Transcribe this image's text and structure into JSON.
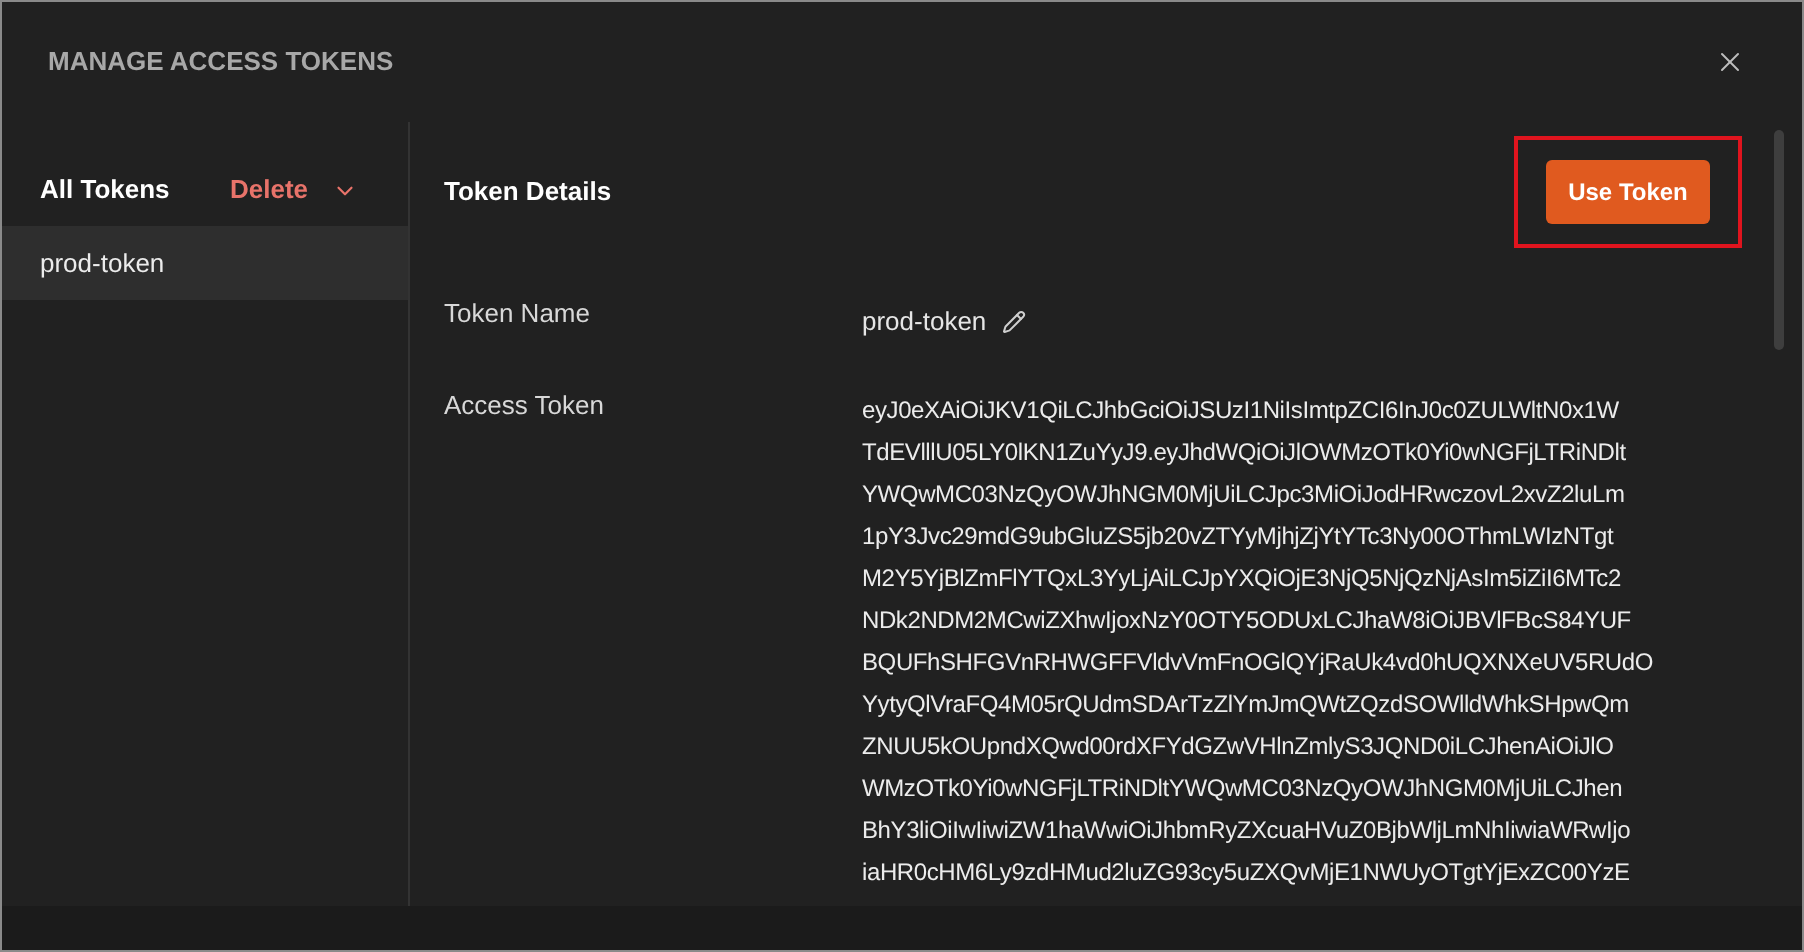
{
  "dialog": {
    "title": "MANAGE ACCESS TOKENS"
  },
  "sidebar": {
    "heading": "All Tokens",
    "delete_label": "Delete",
    "items": [
      {
        "label": "prod-token",
        "selected": true
      }
    ]
  },
  "details": {
    "heading": "Token Details",
    "use_button": "Use Token",
    "highlighted": true,
    "fields": [
      {
        "kind": "name",
        "label": "Token Name",
        "value": "prod-token"
      },
      {
        "kind": "token",
        "label": "Access Token",
        "lines": [
          "eyJ0eXAiOiJKV1QiLCJhbGciOiJSUzI1NiIsImtpZCI6InJ0c0ZULWltN0x1W",
          "TdEVlllU05LY0lKN1ZuYyJ9.eyJhdWQiOiJlOWMzOTk0Yi0wNGFjLTRiNDlt",
          "YWQwMC03NzQyOWJhNGM0MjUiLCJpc3MiOiJodHRwczovL2xvZ2luLm",
          "1pY3Jvc29mdG9ubGluZS5jb20vZTYyMjhjZjYtYTc3Ny00OThmLWIzNTgt",
          "M2Y5YjBlZmFlYTQxL3YyLjAiLCJpYXQiOjE3NjQ5NjQzNjAsIm5iZiI6MTc2",
          "NDk2NDM2MCwiZXhwIjoxNzY0OTY5ODUxLCJhaW8iOiJBVlFBcS84YUF",
          "BQUFhSHFGVnRHWGFFVldvVmFnOGlQYjRaUk4vd0hUQXNXeUV5RUdO",
          "YytyQlVraFQ4M05rQUdmSDArTzZlYmJmQWtZQzdSOWlldWhkSHpwQm",
          "ZNUU5kOUpndXQwd00rdXFYdGZwVHlnZmlyS3JQND0iLCJhenAiOiJlO",
          "WMzOTk0Yi0wNGFjLTRiNDltYWQwMC03NzQyOWJhNGM0MjUiLCJhen",
          "BhY3liOiIwIiwiZW1haWwiOiJhbmRyZXcuaHVuZ0BjbWljLmNhIiwiaWRwIjo",
          "iaHR0cHM6Ly9zdHMud2luZG93cy5uZXQvMjE1NWUyOTgtYjExZC00YzE"
        ]
      }
    ]
  }
}
